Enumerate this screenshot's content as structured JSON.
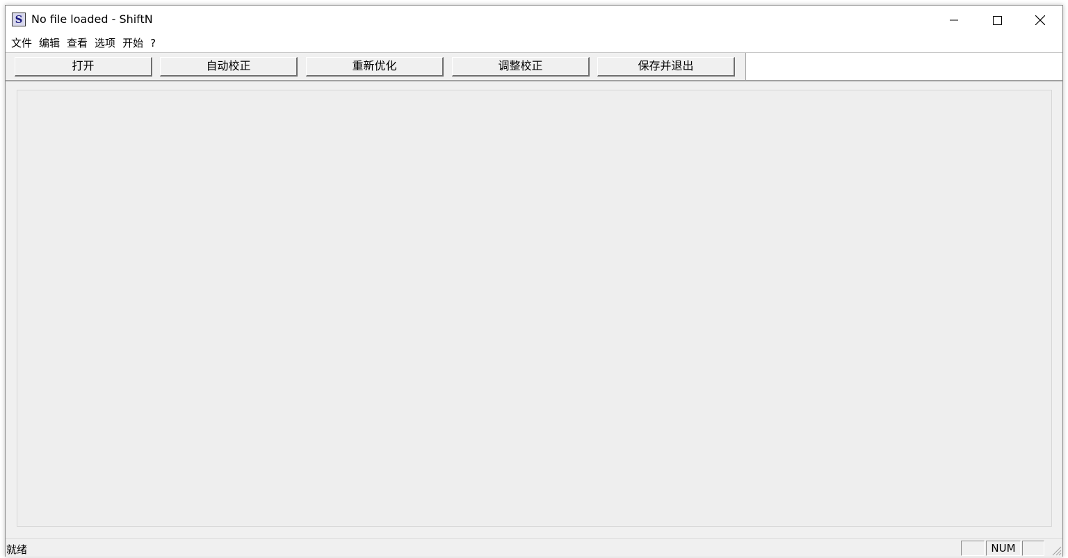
{
  "window": {
    "title": "No file loaded - ShiftN",
    "app_icon_letter": "S",
    "controls": {
      "minimize": "minimize-icon",
      "maximize": "maximize-icon",
      "close": "close-icon"
    }
  },
  "menubar": {
    "items": [
      {
        "label": "文件"
      },
      {
        "label": "编辑"
      },
      {
        "label": "查看"
      },
      {
        "label": "选项"
      },
      {
        "label": "开始"
      },
      {
        "label": "?"
      }
    ]
  },
  "toolbar": {
    "buttons": [
      {
        "label": "打开"
      },
      {
        "label": "自动校正"
      },
      {
        "label": "重新优化"
      },
      {
        "label": "调整校正"
      },
      {
        "label": "保存并退出"
      }
    ]
  },
  "statusbar": {
    "text": "就绪",
    "panes": [
      "",
      "NUM",
      ""
    ]
  }
}
